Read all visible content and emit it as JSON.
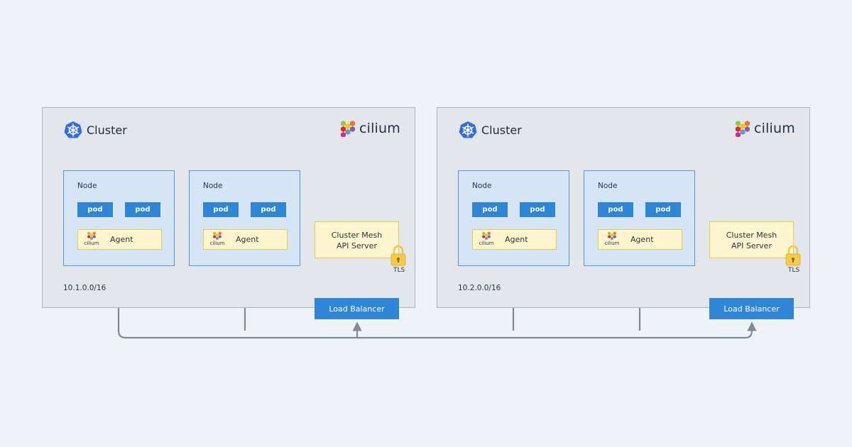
{
  "clusters": [
    {
      "title": "Cluster",
      "brand": "cilium",
      "cidr": "10.1.0.0/16",
      "nodes": [
        {
          "label": "Node",
          "pods": [
            "pod",
            "pod"
          ],
          "agent": {
            "label": "Agent",
            "logo_text": "cilium"
          }
        },
        {
          "label": "Node",
          "pods": [
            "pod",
            "pod"
          ],
          "agent": {
            "label": "Agent",
            "logo_text": "cilium"
          }
        }
      ],
      "apiserver": {
        "line1": "Cluster Mesh",
        "line2": "API Server"
      },
      "tls": "TLS",
      "load_balancer": "Load Balancer"
    },
    {
      "title": "Cluster",
      "brand": "cilium",
      "cidr": "10.2.0.0/16",
      "nodes": [
        {
          "label": "Node",
          "pods": [
            "pod",
            "pod"
          ],
          "agent": {
            "label": "Agent",
            "logo_text": "cilium"
          }
        },
        {
          "label": "Node",
          "pods": [
            "pod",
            "pod"
          ],
          "agent": {
            "label": "Agent",
            "logo_text": "cilium"
          }
        }
      ],
      "apiserver": {
        "line1": "Cluster Mesh",
        "line2": "API Server"
      },
      "tls": "TLS",
      "load_balancer": "Load Balancer"
    }
  ],
  "colors": {
    "background": "#eff2f6",
    "cluster_fill": "#e3e7ec",
    "node_fill": "#d5e5f5",
    "node_border": "#5a95d6",
    "pod": "#2f86d6",
    "agent_fill": "#fff5cf",
    "agent_border": "#e9c94c",
    "connector": "#7e8a98",
    "kubernetes_blue": "#326ce5"
  },
  "icons": {
    "kubernetes": "kubernetes-helm-icon",
    "cilium": "cilium-hexagon-icon",
    "lock": "padlock-icon"
  }
}
